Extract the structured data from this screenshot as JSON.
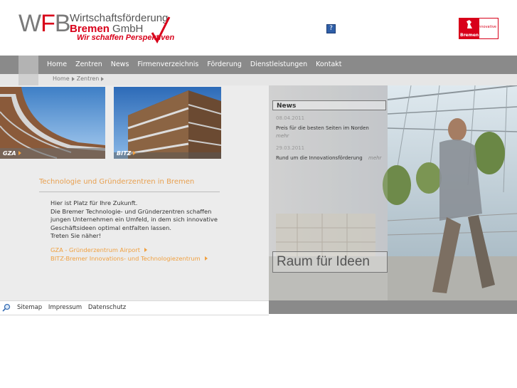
{
  "header": {
    "logo_wfb_w": "W",
    "logo_wfb_f": "F",
    "logo_wfb_b": "B",
    "logo_line1": "Wirtschaftsförderung",
    "logo_line2_red": "Bremen",
    "logo_line2_rest": " GmbH",
    "logo_tagline": "Wir schaffen Perspektiven",
    "help_icon": "?",
    "partner_logo_label": "Bremen",
    "partner_logo_side": "Innovative"
  },
  "nav": {
    "items": [
      "Home",
      "Zentren",
      "News",
      "Firmenverzeichnis",
      "Förderung",
      "Dienstleistungen",
      "Kontakt"
    ]
  },
  "breadcrumb": {
    "items": [
      "Home",
      "Zentren"
    ]
  },
  "tiles": {
    "gza_label": "GZA",
    "bitz_label": "BITZ"
  },
  "main": {
    "heading": "Technologie und Gründerzentren in Bremen",
    "intro_lines": [
      "Hier ist Platz für Ihre Zukunft.",
      "Die Bremer Technologie- und Gründerzentren schaffen",
      "jungen Unternehmen ein Umfeld, in dem sich innovative",
      "Geschäftsideen optimal entfalten lassen.",
      "Treten Sie näher!"
    ],
    "links": [
      "GZA - Gründerzentrum Airport",
      "BITZ-Bremer Innovations- und Technologiezentrum"
    ]
  },
  "news": {
    "title": "News",
    "items": [
      {
        "date": "08.04.2011",
        "text": "Preis für die besten Seiten im Norden",
        "more": "mehr"
      },
      {
        "date": "29.03.2011",
        "text": "Rund um die Innovationsförderung",
        "more": "mehr"
      }
    ]
  },
  "hero": {
    "slogan": "Raum für Ideen"
  },
  "footer": {
    "links": [
      "Sitemap",
      "Impressum",
      "Datenschutz"
    ]
  },
  "colors": {
    "brand_red": "#d8001a",
    "accent_orange": "#f0a040",
    "nav_gray": "#8a8a8a"
  }
}
